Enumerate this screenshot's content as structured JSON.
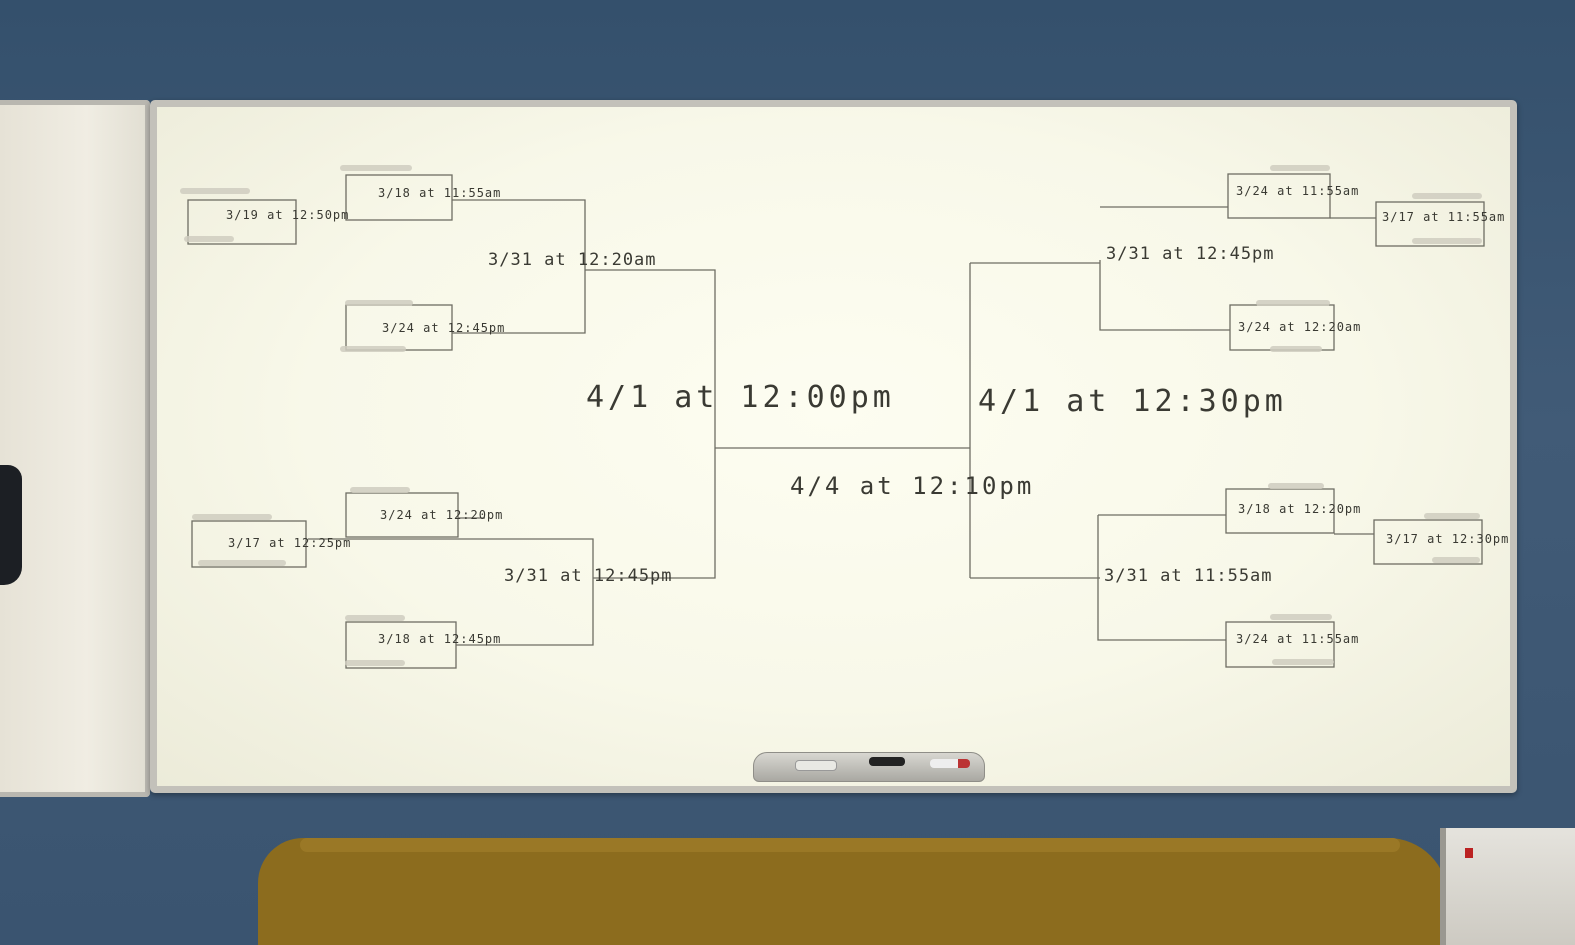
{
  "bracket": {
    "left": {
      "r1a": "3/19 at 12:50pm",
      "r1b": "3/18 at 11:55am",
      "r1c": "3/24 at 12:45pm",
      "r1d": "3/17 at 12:25pm",
      "r1e": "3/24 at 12:20pm",
      "r1f": "3/18 at 12:45pm",
      "r2a": "3/31 at 12:20am",
      "r2b": "3/31 at 12:45pm",
      "r3": "4/1 at 12:00pm"
    },
    "final": "4/4 at 12:10pm",
    "right": {
      "r1a": "3/24 at 11:55am",
      "r1b": "3/17 at 11:55am",
      "r1c": "3/24 at 12:20am",
      "r1d": "3/18 at 12:20pm",
      "r1e": "3/17 at 12:30pm",
      "r1f": "3/24 at 11:55am",
      "r2a": "3/31 at 12:45pm",
      "r2b": "3/31 at 11:55am",
      "r3": "4/1 at 12:30pm"
    }
  },
  "colors": {
    "wall": "#3e5873",
    "whiteboard": "#f8f8e9",
    "frame": "#c3c1ba",
    "ink": "#3a3a33",
    "desk": "#8c6c1e"
  }
}
